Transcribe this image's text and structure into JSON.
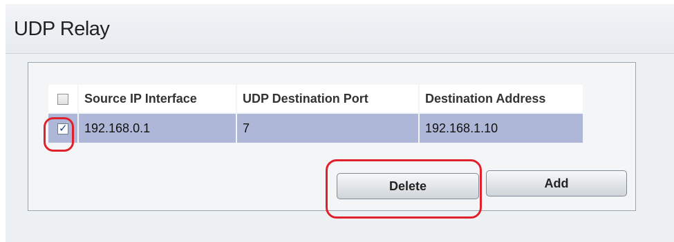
{
  "page": {
    "title": "UDP Relay"
  },
  "table": {
    "columns": [
      "Source IP Interface",
      "UDP Destination Port",
      "Destination Address"
    ],
    "rows": [
      {
        "selected": true,
        "source_ip_interface": "192.168.0.1",
        "udp_destination_port": "7",
        "destination_address": "192.168.1.10"
      }
    ]
  },
  "buttons": {
    "delete_label": "Delete",
    "add_label": "Add"
  },
  "colors": {
    "row_highlight": "#aeb7d7",
    "annotation_red": "#e0202a",
    "panel_background": "#eef1f4"
  }
}
